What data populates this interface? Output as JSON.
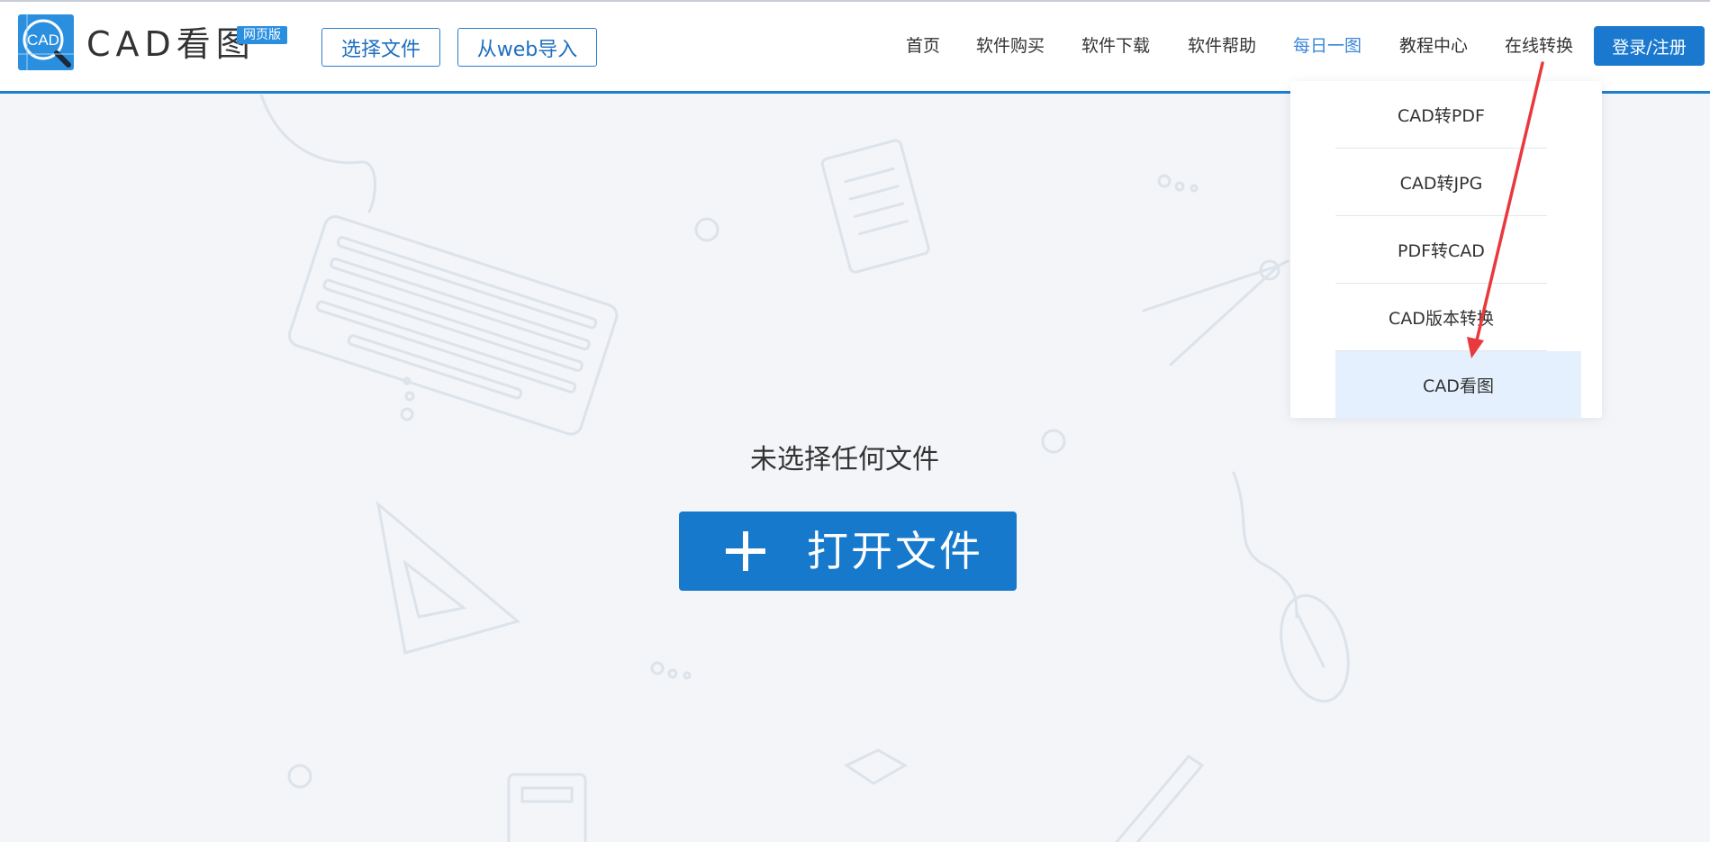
{
  "header": {
    "logo_text": "CAD",
    "brand": "CAD看图",
    "badge": "网页版",
    "select_file_label": "选择文件",
    "web_import_label": "从web导入",
    "nav": [
      {
        "label": "首页"
      },
      {
        "label": "软件购买"
      },
      {
        "label": "软件下载"
      },
      {
        "label": "软件帮助"
      },
      {
        "label": "每日一图"
      },
      {
        "label": "教程中心"
      },
      {
        "label": "在线转换"
      }
    ],
    "active_nav": "每日一图",
    "login_label": "登录/注册"
  },
  "dropdown": {
    "items": [
      {
        "label": "CAD转PDF"
      },
      {
        "label": "CAD转JPG"
      },
      {
        "label": "PDF转CAD"
      },
      {
        "label": "CAD版本转换"
      },
      {
        "label": "CAD看图"
      }
    ],
    "highlighted": "CAD看图"
  },
  "main": {
    "status_text": "未选择任何文件",
    "open_file_label": "打开文件"
  },
  "colors": {
    "primary": "#1679cc",
    "nav_active": "#3b87d8",
    "dropdown_highlight": "#e4f0fd",
    "annotation_arrow": "#e8393d"
  }
}
